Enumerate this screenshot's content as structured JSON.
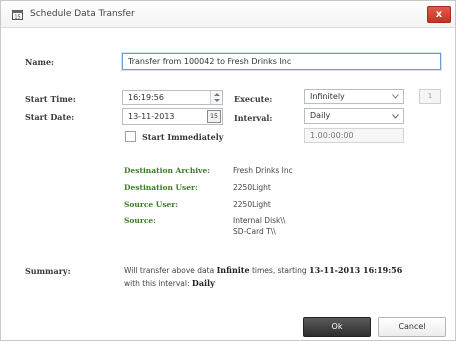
{
  "window": {
    "title": "Schedule Data Transfer",
    "close_label": "x"
  },
  "form": {
    "name_label": "Name:",
    "name_value": "Transfer from 100042 to Fresh Drinks Inc",
    "start_time_label": "Start Time:",
    "start_time_value": "16:19:56",
    "start_date_label": "Start Date:",
    "start_date_value": "13-11-2013",
    "calendar_label": "15",
    "start_immediately_label": "Start Immediately",
    "execute_label": "Execute:",
    "execute_value": "Infinitely",
    "execute_count": "1",
    "interval_label": "Interval:",
    "interval_value": "Daily",
    "interval_duration": "1.00:00:00"
  },
  "details": {
    "destination_archive_label": "Destination Archive:",
    "destination_archive_value": "Fresh Drinks Inc",
    "destination_user_label": "Destination User:",
    "destination_user_value": "2250Light",
    "source_user_label": "Source User:",
    "source_user_value": "2250Light",
    "source_label": "Source:",
    "source_value_1": "Internal Disk\\\\",
    "source_value_2": "SD-Card T\\\\"
  },
  "summary": {
    "label": "Summary:",
    "text_1": "Will transfer above data",
    "times_value": "Infinite",
    "text_2": "times, starting",
    "start_value": "13-11-2013 16:19:56",
    "text_3": "with this interval:",
    "interval_value": "Daily"
  },
  "buttons": {
    "ok_label": "Ok",
    "cancel_label": "Cancel"
  },
  "colors": {
    "accent_green": "#3c7a2a",
    "ok_button": "#3a3a3a",
    "close_button": "#d2432f"
  }
}
